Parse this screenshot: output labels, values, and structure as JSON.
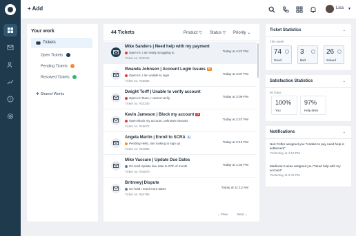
{
  "rail": {
    "icons": [
      "logo-icon",
      "dashboard-icon",
      "inbox-icon",
      "contacts-icon",
      "reports-icon",
      "help-icon",
      "settings-icon"
    ]
  },
  "topbar": {
    "add_label": "+ Add",
    "user_name": "Lisa"
  },
  "nav": {
    "title": "Your work",
    "tickets_label": "Tickets",
    "sub_items": [
      {
        "label": "Open Tickets",
        "color": "#1f3a4d"
      },
      {
        "label": "Pending Tickets",
        "color": "#f28c28"
      },
      {
        "label": "Resolved Tickets",
        "color": "#2bb673"
      }
    ],
    "shared_label": "Shared Works"
  },
  "list": {
    "count": "44 Tickets",
    "filters": [
      "Product",
      "Status",
      "Priority"
    ],
    "rows": [
      {
        "title": "Mike Sanders | Need help with my payment",
        "status": "Open",
        "status_color": "#e23b3b",
        "snippet": "Hi, I am really struggling to",
        "ticket": "Ticket no: #25245",
        "time": "Today at 4:27 PM",
        "badge": ""
      },
      {
        "title": "Rwanda Johnson | Account Login Issues",
        "status": "Open",
        "status_color": "#e23b3b",
        "snippet": "Hi, I am unable to login",
        "ticket": "Ticket no: #25584",
        "time": "Today at 3:37 PM",
        "badge": "M"
      },
      {
        "title": "Dwight Torff | Unable to verify account",
        "status": "Open",
        "status_color": "#e23b3b",
        "snippet": "Hi Team, I cannot verify",
        "ticket": "Ticket no: #32245",
        "time": "Today at 3:09 PM",
        "badge": ""
      },
      {
        "title": "Kevin Jameson | Block my account",
        "status": "Open",
        "status_color": "#e23b3b",
        "snippet": "Block my account, unknown transact",
        "ticket": "Ticket no: #45672",
        "time": "Today at 2:47 PM",
        "badge": "H"
      },
      {
        "title": "Angela Martin | Enroll to SCRA",
        "status": "Pending",
        "status_color": "#f28c28",
        "snippet": "Hello, iam looking to sign up",
        "ticket": "Ticket no: #54886",
        "time": "Today at 2:13 PM",
        "badge": "L"
      },
      {
        "title": "Mike Vaccaro | Update Due Dates",
        "status": "On-hold",
        "status_color": "#6b7a89",
        "snippet": "Update due date to 27th of month",
        "ticket": "Ticket no: #34879",
        "time": "Today at 1:34 PM",
        "badge": ""
      },
      {
        "title": "Britnney| Dispute",
        "status": "On-hold",
        "status_color": "#6b7a89",
        "snippet": "I need more tubes",
        "ticket": "Ticket no: #54786",
        "time": "Today at 11:13 AM",
        "badge": ""
      }
    ],
    "prev_label": "Prev",
    "next_label": "Next"
  },
  "ticket_stats": {
    "title": "Ticket Statistics",
    "period": "This week",
    "items": [
      {
        "value": "74",
        "label": "Good"
      },
      {
        "value": "3",
        "label": "Bad"
      },
      {
        "value": "26",
        "label": "Solved"
      }
    ]
  },
  "satisfaction": {
    "title": "Satisfaction Statistics",
    "period": "60 Days",
    "items": [
      {
        "value": "100%",
        "label": "You"
      },
      {
        "value": "97%",
        "label": "Help desk"
      }
    ]
  },
  "notifications": {
    "title": "Notifications",
    "items": [
      {
        "text": "Ned Coffer assigned you \"Unable to pay need help in settlement\"",
        "time": "Yesterday at 4:13 PM"
      },
      {
        "text": "Madinson Lukas assigned you \"Need help with my account\"",
        "time": "Yesterday at 3:42 PM"
      }
    ]
  }
}
